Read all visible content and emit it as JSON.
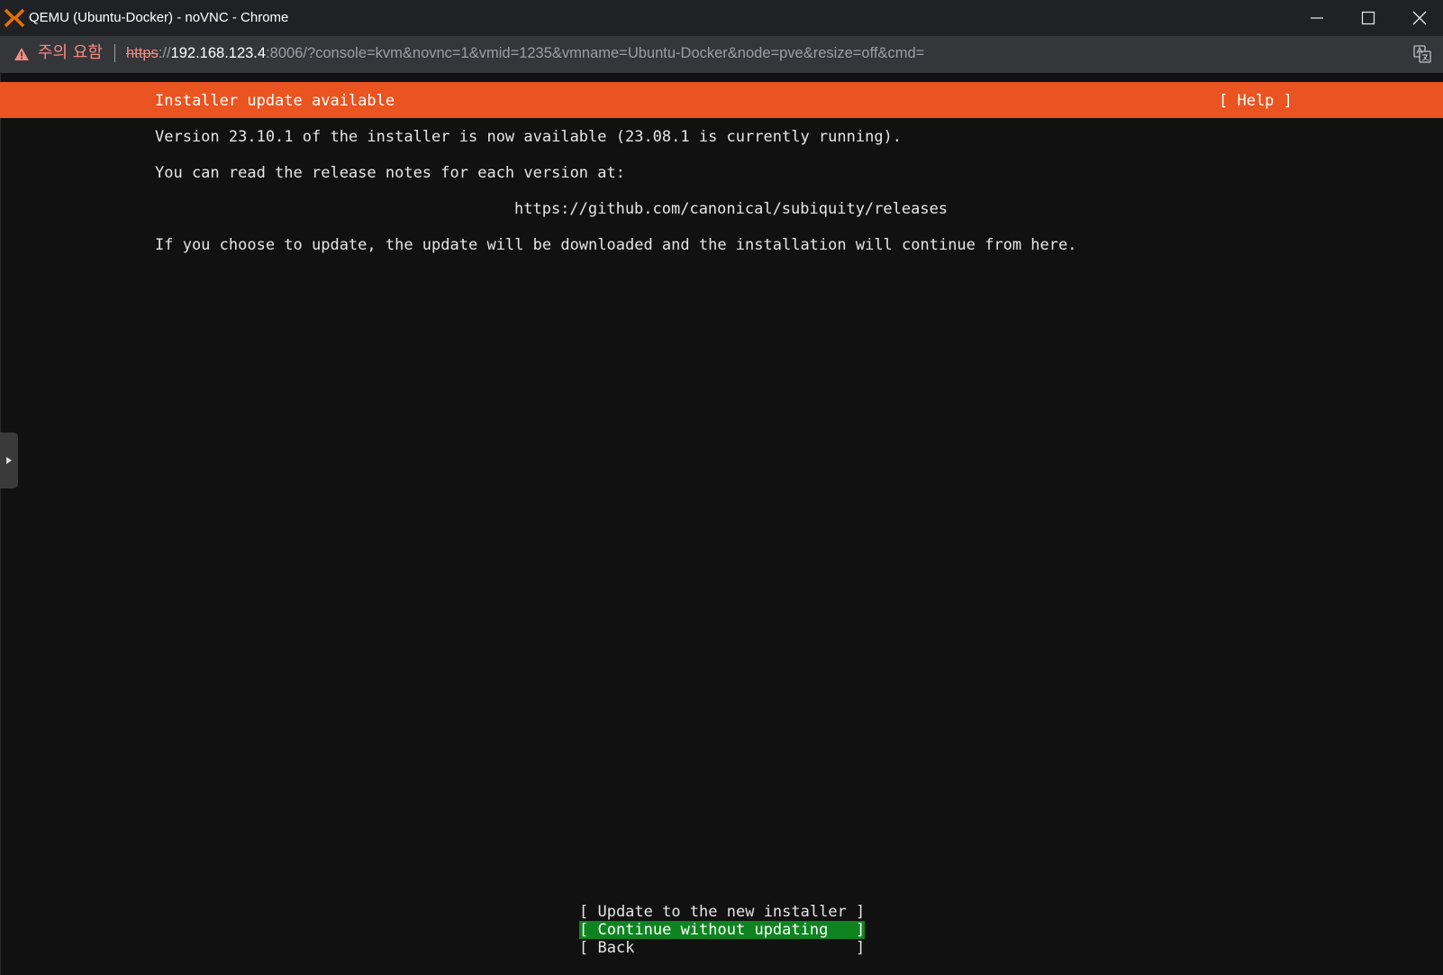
{
  "window": {
    "title": "QEMU (Ubuntu-Docker) - noVNC - Chrome",
    "icons": [
      "app-logo-icon",
      "minimize-icon",
      "maximize-icon",
      "close-icon"
    ],
    "accent": "#e57000"
  },
  "address_bar": {
    "warning_label": "주의 요함",
    "url_scheme": "https",
    "url_sep": "://",
    "url_host": "192.168.123.4",
    "url_rest": ":8006/?console=kvm&novnc=1&vmid=1235&vmname=Ubuntu-Docker&node=pve&resize=off&cmd=",
    "icons": [
      "warning-icon",
      "translate-icon"
    ]
  },
  "installer": {
    "header_title": "Installer update available",
    "help_label": "[ Help ]",
    "header_color": "#e95420",
    "lines": [
      "Version 23.10.1 of the installer is now available (23.08.1 is currently running).",
      "You can read the release notes for each version at:",
      "https://github.com/canonical/subiquity/releases",
      "If you choose to update, the update will be downloaded and the installation will continue from here."
    ],
    "menu": [
      "[ Update to the new installer ]",
      "[ Continue without updating   ]",
      "[ Back                        ]"
    ],
    "selected_index": 1,
    "selected_color": "#0e8420"
  },
  "novnc": {
    "sidebar_handle_icon": "expand-arrow-icon"
  }
}
